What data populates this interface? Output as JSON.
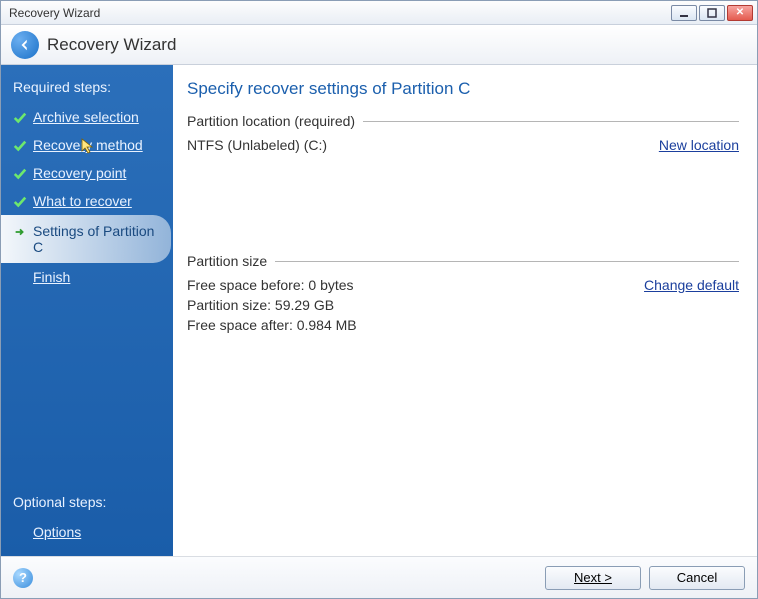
{
  "window": {
    "title": "Recovery Wizard"
  },
  "header": {
    "title": "Recovery Wizard"
  },
  "sidebar": {
    "required_heading": "Required steps:",
    "optional_heading": "Optional steps:",
    "steps": [
      {
        "label": "Archive selection"
      },
      {
        "label": "Recovery method"
      },
      {
        "label": "Recovery point"
      },
      {
        "label": "What to recover"
      },
      {
        "label": "Settings of Partition C"
      },
      {
        "label": "Finish"
      }
    ],
    "options_label": "Options"
  },
  "main": {
    "heading": "Specify recover settings of Partition C",
    "location": {
      "header": "Partition location (required)",
      "value": "NTFS (Unlabeled) (C:)",
      "link": "New location"
    },
    "size": {
      "header": "Partition size",
      "before": "Free space before: 0 bytes",
      "partition": "Partition size: 59.29 GB",
      "after": "Free space after: 0.984 MB",
      "link": "Change default"
    }
  },
  "footer": {
    "next": "Next >",
    "cancel": "Cancel"
  }
}
